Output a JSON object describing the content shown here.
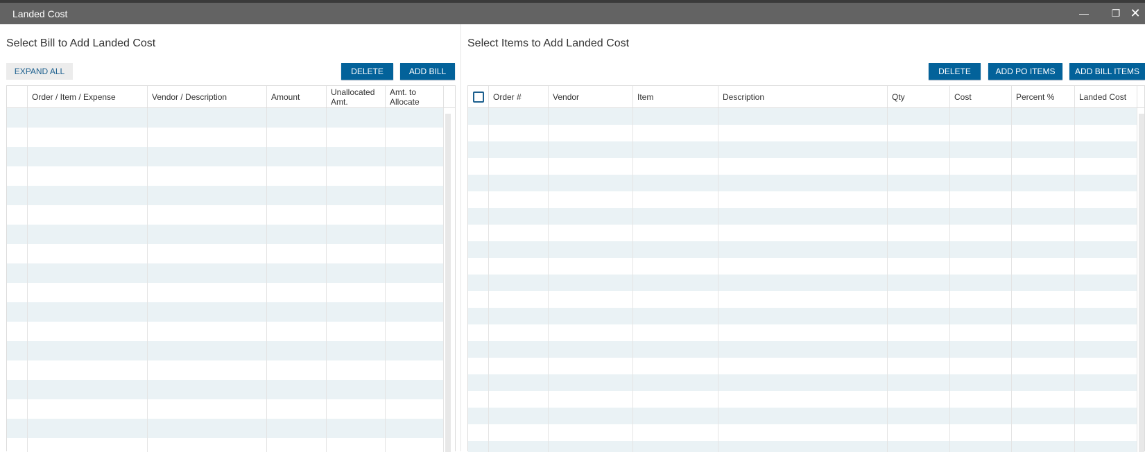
{
  "window": {
    "title": "Landed Cost",
    "minimize_icon": "minimize-icon",
    "restore_icon": "restore-icon",
    "close_icon": "close-icon"
  },
  "left": {
    "heading": "Select Bill to Add Landed Cost",
    "expand_all": "EXPAND ALL",
    "delete": "DELETE",
    "add_bill": "ADD BILL",
    "columns": [
      "",
      "Order / Item / Expense",
      "Vendor / Description",
      "Amount",
      "Unallocated Amt.",
      "Amt. to Allocate"
    ]
  },
  "right": {
    "heading": "Select Items to Add Landed Cost",
    "delete": "DELETE",
    "add_po_items": "ADD PO ITEMS",
    "add_bill_items": "ADD BILL ITEMS",
    "columns": [
      "",
      "Order #",
      "Vendor",
      "Item",
      "Description",
      "Qty",
      "Cost",
      "Percent %",
      "Landed Cost"
    ]
  },
  "colors": {
    "accent": "#03629a",
    "stripe": "#eaf2f5",
    "titlebar": "#636363"
  }
}
